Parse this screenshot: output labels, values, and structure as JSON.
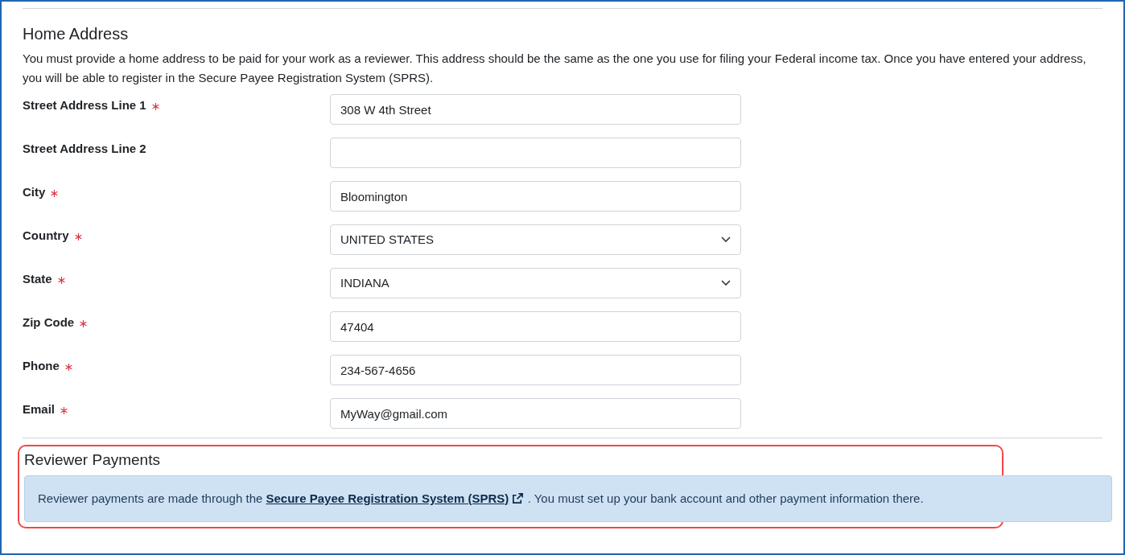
{
  "home_address": {
    "title": "Home Address",
    "description": "You must provide a home address to be paid for your work as a reviewer. This address should be the same as the one you use for filing your Federal income tax. Once you have entered your address, you will be able to register in the Secure Payee Registration System (SPRS).",
    "fields": [
      {
        "label": "Street Address Line 1",
        "required": true,
        "kind": "text",
        "value": "308 W 4th Street"
      },
      {
        "label": "Street Address Line 2",
        "required": false,
        "kind": "text"
      },
      {
        "label": "City",
        "required": true,
        "kind": "text",
        "value": "Bloomington"
      },
      {
        "label": "Country",
        "required": true,
        "kind": "select",
        "value": "UNITED STATES"
      },
      {
        "label": "State",
        "required": true,
        "kind": "select",
        "value": "INDIANA"
      },
      {
        "label": "Zip Code",
        "required": true,
        "kind": "text",
        "value": "47404"
      },
      {
        "label": "Phone",
        "required": true,
        "kind": "text",
        "value": "234-567-4656"
      },
      {
        "label": "Email",
        "required": true,
        "kind": "text",
        "value": "MyWay@gmail.com"
      }
    ]
  },
  "reviewer_payments": {
    "title": "Reviewer Payments",
    "highlighted": true,
    "notice_before": "Reviewer payments are made through the",
    "link": "Secure Payee Registration System (SPRS)",
    "notice_after": ". You must set up your bank account and other payment information there."
  }
}
